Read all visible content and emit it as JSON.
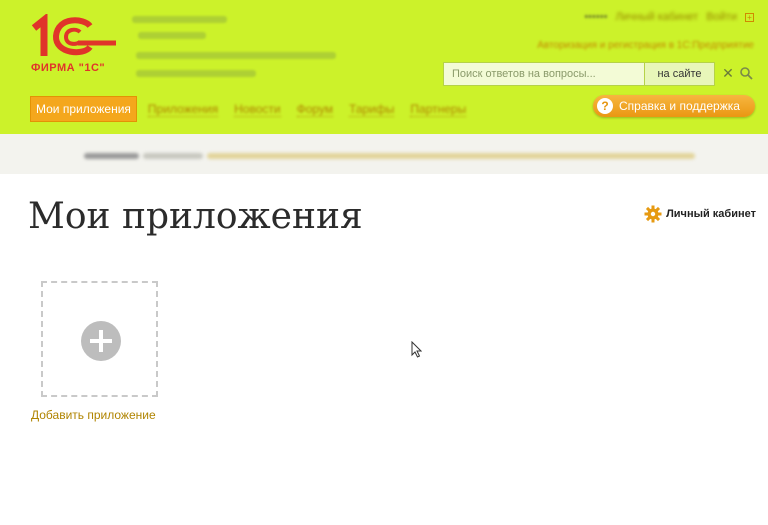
{
  "header": {
    "logo": {
      "mark": "1С",
      "subtitle": "ФИРМА \"1С\""
    },
    "top_links": {
      "blurred_name": "••••••",
      "cabinet": "Личный кабинет",
      "login": "Войти"
    },
    "top_sub": "Авторизация и регистрация в 1С:Предприятие",
    "search": {
      "placeholder": "Поиск ответов на вопросы...",
      "scope": "на сайте"
    },
    "nav": {
      "active": "Мои приложения",
      "items": [
        "Приложения",
        "Новости",
        "Форум",
        "Тарифы",
        "Партнеры"
      ]
    },
    "help_button": "Справка и поддержка"
  },
  "main": {
    "title": "Мои приложения",
    "cabinet_link": "Личный кабинет",
    "add_app_label": "Добавить приложение"
  },
  "colors": {
    "header_bg": "#ccf22a",
    "accent_orange": "#f4a71c",
    "link_gold": "#b08400",
    "logo_red": "#e0342a"
  },
  "icons": [
    "logo-1c",
    "clear-icon",
    "search-icon",
    "help-icon",
    "gear-icon",
    "plus-icon",
    "mouse-cursor-icon"
  ]
}
